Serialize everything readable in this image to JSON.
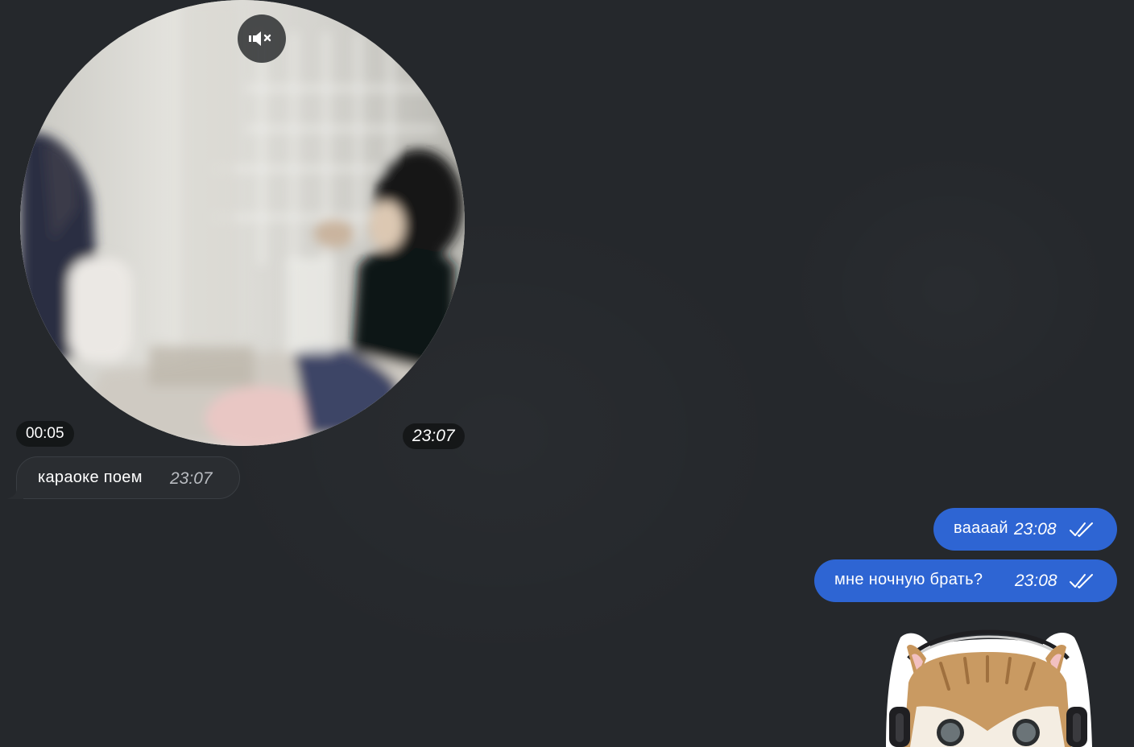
{
  "video_message": {
    "duration": "00:05",
    "time": "23:07",
    "mute_icon": "speaker-muted-icon"
  },
  "incoming": {
    "text": "караоке поем",
    "time": "23:07"
  },
  "outgoing": [
    {
      "text": "ваааай",
      "time": "23:08",
      "status_icon": "double-check-icon"
    },
    {
      "text": "мне ночную брать?",
      "time": "23:08",
      "status_icon": "double-check-icon"
    }
  ],
  "sticker": {
    "icon": "cat-with-headphones-sticker"
  },
  "colors": {
    "background": "#25282c",
    "incoming_bubble": "#2a2d31",
    "outgoing_bubble": "#2e65d3"
  }
}
